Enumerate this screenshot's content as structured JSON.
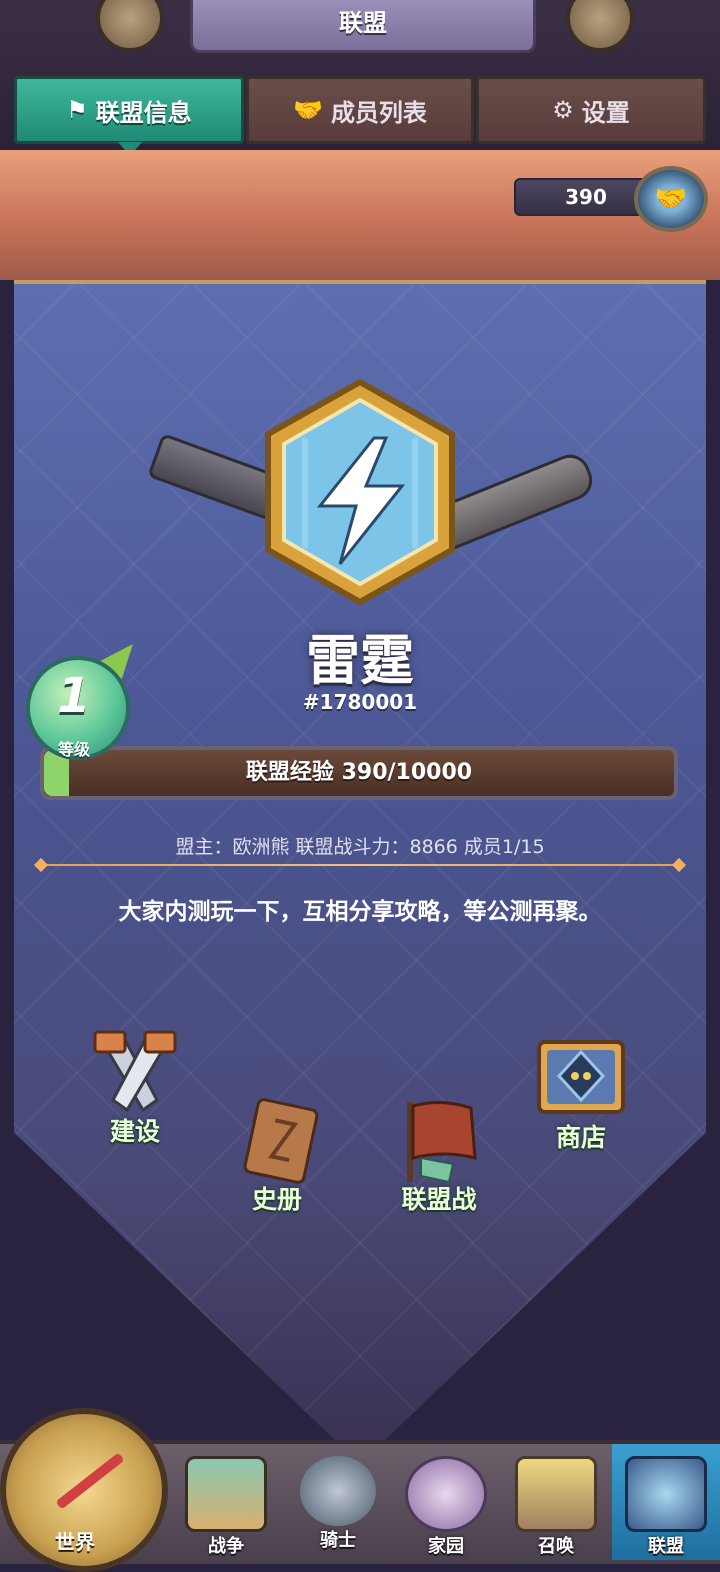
{
  "header": {
    "title": "联盟"
  },
  "tabs": [
    {
      "label": "联盟信息",
      "icon": "flag-icon",
      "active": true
    },
    {
      "label": "成员列表",
      "icon": "handshake-icon",
      "active": false
    },
    {
      "label": "设置",
      "icon": "gear-icon",
      "active": false
    }
  ],
  "exp_counter": {
    "value": "390"
  },
  "alliance": {
    "name": "雷霆",
    "id": "#1780001",
    "level": "1",
    "level_label": "等级",
    "exp_text": "联盟经验 390/10000",
    "exp_current": 390,
    "exp_max": 10000,
    "info_line": "盟主：欧洲熊  联盟战斗力：8866 成员1/15",
    "notice": "大家内测玩一下，互相分享攻略，等公测再聚。"
  },
  "features": [
    {
      "label": "建设",
      "icon": "saws-icon"
    },
    {
      "label": "史册",
      "icon": "book-icon"
    },
    {
      "label": "联盟战",
      "icon": "war-flag-icon"
    },
    {
      "label": "商店",
      "icon": "shop-icon"
    }
  ],
  "nav": [
    {
      "label": "世界",
      "icon": "compass-icon"
    },
    {
      "label": "战争",
      "icon": "map-icon"
    },
    {
      "label": "骑士",
      "icon": "knight-icon"
    },
    {
      "label": "家园",
      "icon": "home-gear-icon"
    },
    {
      "label": "召唤",
      "icon": "summon-icon"
    },
    {
      "label": "联盟",
      "icon": "alliance-icon",
      "active": true
    }
  ],
  "colors": {
    "tab_active": "#1f8a75",
    "accent_orange": "#c8745a",
    "exp_fill": "#8fd46a"
  }
}
